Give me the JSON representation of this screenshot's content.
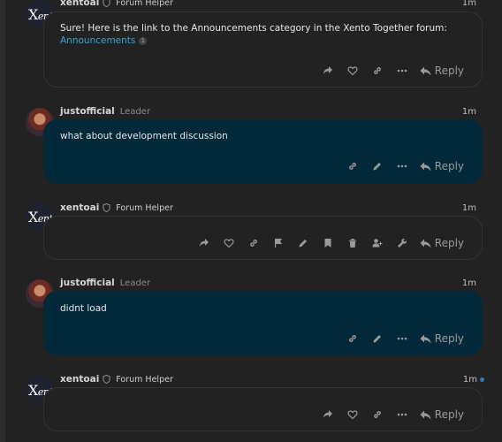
{
  "colors": {
    "background": "#222222",
    "own_post_bg": "#02293a",
    "link": "#3aa0d9",
    "new_dot": "#2e7ab8"
  },
  "posts": [
    {
      "username": "xentoai",
      "title": "Forum Helper",
      "time": "1m",
      "body_text": "Sure! Here is the link to the Announcements category in the Xento Together forum:",
      "link_text": "Announcements",
      "link_count": "1",
      "actions": [
        "share-icon",
        "like-icon",
        "link-icon",
        "more-icon"
      ],
      "reply_label": "Reply"
    },
    {
      "username": "justofficial",
      "title": "Leader",
      "time": "1m",
      "body_text": "what about development discussion",
      "actions": [
        "link-icon",
        "edit-icon",
        "more-icon"
      ],
      "reply_label": "Reply"
    },
    {
      "username": "xentoai",
      "title": "Forum Helper",
      "time": "1m",
      "body_text": "",
      "actions": [
        "share-icon",
        "like-icon",
        "link-icon",
        "flag-icon",
        "edit-icon",
        "bookmark-icon",
        "delete-icon",
        "user-add-icon",
        "wrench-icon"
      ],
      "reply_label": "Reply"
    },
    {
      "username": "justofficial",
      "title": "Leader",
      "time": "1m",
      "body_text": "didnt load",
      "actions": [
        "link-icon",
        "edit-icon",
        "more-icon"
      ],
      "reply_label": "Reply"
    },
    {
      "username": "xentoai",
      "title": "Forum Helper",
      "time": "1m",
      "body_text": "",
      "actions": [
        "share-icon",
        "like-icon",
        "link-icon",
        "more-icon"
      ],
      "reply_label": "Reply"
    }
  ],
  "avatar_logo": {
    "big": "X",
    "small": "ento"
  }
}
